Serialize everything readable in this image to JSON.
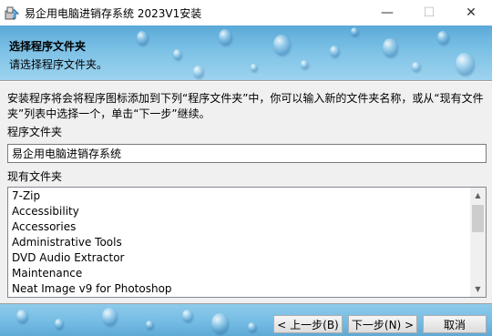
{
  "window": {
    "title": "易企用电脑进销存系统 2023V1安装",
    "minimize_glyph": "—",
    "maximize_glyph": "☐",
    "close_glyph": "✕"
  },
  "header": {
    "title": "选择程序文件夹",
    "subtitle": "请选择程序文件夹。"
  },
  "body": {
    "description": "安装程序将会将程序图标添加到下列“程序文件夹”中，你可以输入新的文件夹名称，或从“现有文件夹”列表中选择一个，单击“下一步”继续。",
    "folder_label": "程序文件夹",
    "folder_value": "易企用电脑进销存系统",
    "existing_label": "现有文件夹",
    "existing_folders": [
      "7-Zip",
      "Accessibility",
      "Accessories",
      "Administrative Tools",
      "DVD Audio Extractor",
      "Maintenance",
      "Neat Image v9 for Photoshop"
    ]
  },
  "buttons": {
    "back": "< 上一步(B)",
    "next": "下一步(N) >",
    "cancel": "取消"
  },
  "colors": {
    "header_blue": "#7cc1e6",
    "footer_blue": "#73bbe3"
  },
  "icons": [
    "installer-icon",
    "chevron-up-icon",
    "chevron-down-icon"
  ]
}
